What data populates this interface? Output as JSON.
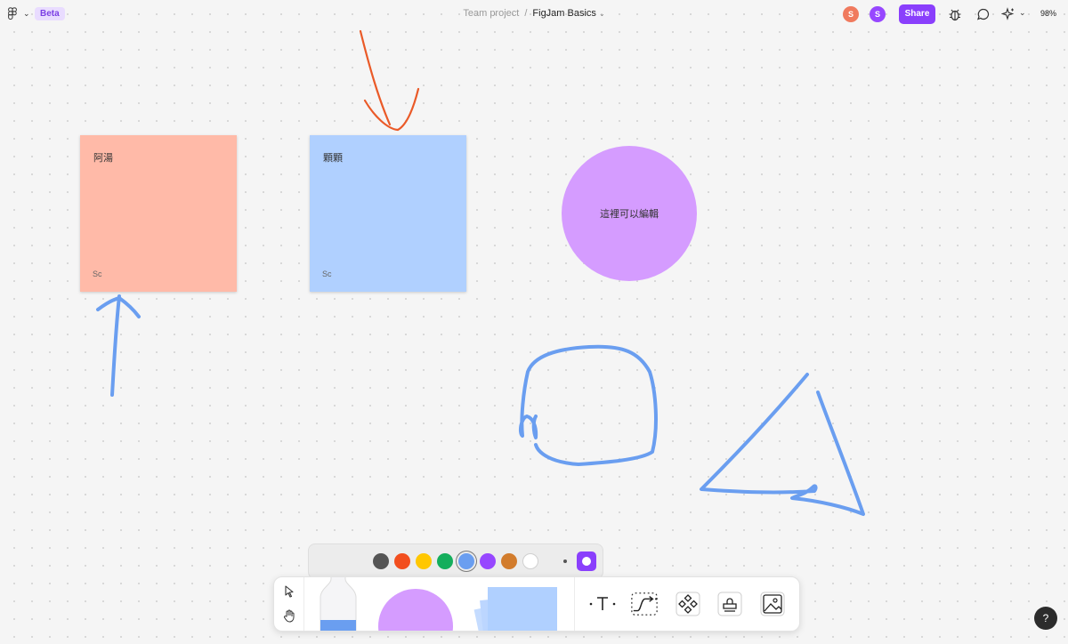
{
  "header": {
    "beta_label": "Beta",
    "project": "Team project",
    "separator": "/",
    "file_name": "FigJam Basics",
    "avatars": [
      {
        "initial": "S",
        "color": "#f07a5e"
      },
      {
        "initial": "S",
        "color": "#9747ff"
      }
    ],
    "share_label": "Share",
    "zoom": "98%"
  },
  "canvas": {
    "stickies": [
      {
        "text": "阿湯",
        "author": "Sc",
        "color": "#ffbaa8"
      },
      {
        "text": "顆顆",
        "author": "Sc",
        "color": "#b0d0ff"
      }
    ],
    "circle": {
      "text": "這裡可以編輯",
      "color": "#d59cff"
    },
    "ink_colors": {
      "orange": "#ea5a28",
      "blue": "#6a9ef0"
    }
  },
  "toolbar": {
    "colors": [
      {
        "name": "dark-gray",
        "hex": "#545454"
      },
      {
        "name": "red",
        "hex": "#f24e1e"
      },
      {
        "name": "yellow",
        "hex": "#ffc700"
      },
      {
        "name": "green",
        "hex": "#14ae5c"
      },
      {
        "name": "blue",
        "hex": "#6a9ef0",
        "selected": true
      },
      {
        "name": "purple",
        "hex": "#9747ff"
      },
      {
        "name": "brown",
        "hex": "#d27c2c"
      },
      {
        "name": "white",
        "hex": "#ffffff"
      }
    ],
    "tools": [
      "select-icon",
      "hand-icon",
      "marker-icon",
      "shape-icon",
      "sticky-icon",
      "text-icon",
      "connector-icon",
      "component-icon",
      "stamp-icon",
      "image-icon"
    ],
    "help_label": "?"
  }
}
